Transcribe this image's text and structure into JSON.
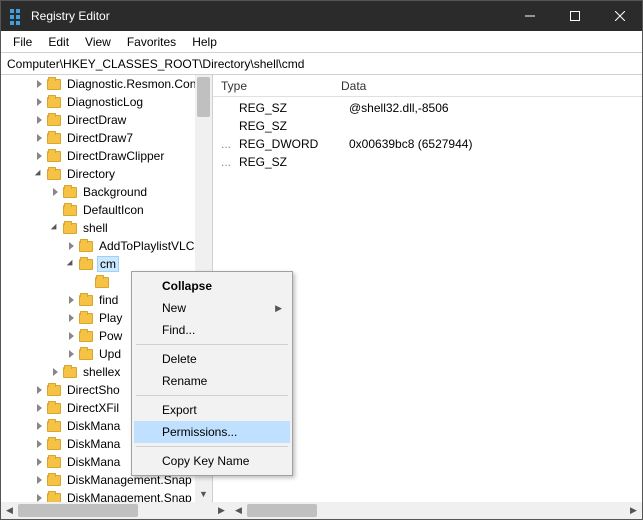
{
  "window": {
    "title": "Registry Editor"
  },
  "menu": {
    "items": [
      "File",
      "Edit",
      "View",
      "Favorites",
      "Help"
    ]
  },
  "address": {
    "value": "Computer\\HKEY_CLASSES_ROOT\\Directory\\shell\\cmd"
  },
  "tree": {
    "items": [
      {
        "level": 2,
        "exp": "closed",
        "label": "Diagnostic.Resmon.Con"
      },
      {
        "level": 2,
        "exp": "closed",
        "label": "DiagnosticLog"
      },
      {
        "level": 2,
        "exp": "closed",
        "label": "DirectDraw"
      },
      {
        "level": 2,
        "exp": "closed",
        "label": "DirectDraw7"
      },
      {
        "level": 2,
        "exp": "closed",
        "label": "DirectDrawClipper"
      },
      {
        "level": 2,
        "exp": "open",
        "label": "Directory"
      },
      {
        "level": 3,
        "exp": "closed",
        "label": "Background"
      },
      {
        "level": 3,
        "exp": "none",
        "label": "DefaultIcon"
      },
      {
        "level": 3,
        "exp": "open",
        "label": "shell"
      },
      {
        "level": 4,
        "exp": "closed",
        "label": "AddToPlaylistVLC"
      },
      {
        "level": 4,
        "exp": "open",
        "label": "cm",
        "selected": true
      },
      {
        "level": 5,
        "exp": "none",
        "label": ""
      },
      {
        "level": 4,
        "exp": "closed",
        "label": "find"
      },
      {
        "level": 4,
        "exp": "closed",
        "label": "Play"
      },
      {
        "level": 4,
        "exp": "closed",
        "label": "Pow"
      },
      {
        "level": 4,
        "exp": "closed",
        "label": "Upd"
      },
      {
        "level": 3,
        "exp": "closed",
        "label": "shellex"
      },
      {
        "level": 2,
        "exp": "closed",
        "label": "DirectSho"
      },
      {
        "level": 2,
        "exp": "closed",
        "label": "DirectXFil"
      },
      {
        "level": 2,
        "exp": "closed",
        "label": "DiskMana"
      },
      {
        "level": 2,
        "exp": "closed",
        "label": "DiskMana"
      },
      {
        "level": 2,
        "exp": "closed",
        "label": "DiskMana"
      },
      {
        "level": 2,
        "exp": "closed",
        "label": "DiskManagement.Snap"
      },
      {
        "level": 2,
        "exp": "closed",
        "label": "DiskManagement.Snap"
      }
    ]
  },
  "list": {
    "cols": {
      "type": "Type",
      "data": "Data"
    },
    "rows": [
      {
        "type": "REG_SZ",
        "data": "@shell32.dll,-8506",
        "trunc": false
      },
      {
        "type": "REG_SZ",
        "data": "",
        "trunc": false
      },
      {
        "type": "REG_DWORD",
        "data": "0x00639bc8 (6527944)",
        "trunc": true
      },
      {
        "type": "REG_SZ",
        "data": "",
        "trunc": true
      }
    ]
  },
  "context": {
    "items": [
      {
        "label": "Collapse",
        "bold": true
      },
      {
        "label": "New",
        "submenu": true
      },
      {
        "label": "Find..."
      },
      {
        "sep": true
      },
      {
        "label": "Delete"
      },
      {
        "label": "Rename"
      },
      {
        "sep": true
      },
      {
        "label": "Export"
      },
      {
        "label": "Permissions...",
        "highlight": true
      },
      {
        "sep": true
      },
      {
        "label": "Copy Key Name"
      }
    ]
  }
}
